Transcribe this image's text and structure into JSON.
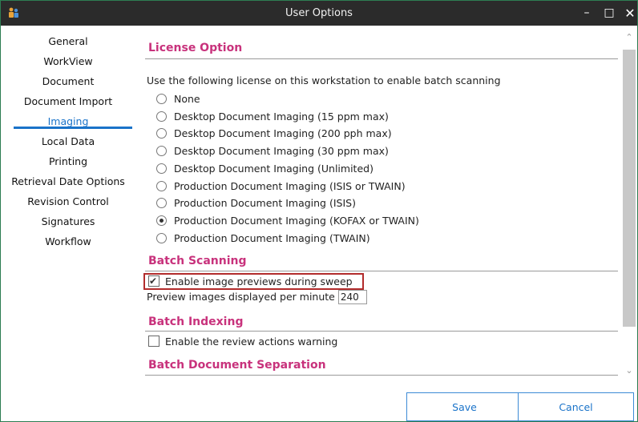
{
  "window": {
    "title": "User Options",
    "minimize_glyph": "–",
    "maximize_glyph": "□",
    "close_glyph": "✕"
  },
  "sidebar": {
    "items": [
      {
        "label": "General"
      },
      {
        "label": "WorkView"
      },
      {
        "label": "Document"
      },
      {
        "label": "Document Import"
      },
      {
        "label": "Imaging",
        "active": true
      },
      {
        "label": "Local Data"
      },
      {
        "label": "Printing"
      },
      {
        "label": "Retrieval Date Options"
      },
      {
        "label": "Revision Control"
      },
      {
        "label": "Signatures"
      },
      {
        "label": "Workflow"
      }
    ]
  },
  "license": {
    "title": "License Option",
    "description": "Use the following license on this workstation to enable batch scanning",
    "options": [
      {
        "label": "None",
        "selected": false
      },
      {
        "label": "Desktop Document Imaging (15 ppm max)",
        "selected": false
      },
      {
        "label": "Desktop Document Imaging (200 pph max)",
        "selected": false
      },
      {
        "label": "Desktop Document Imaging (30 ppm max)",
        "selected": false
      },
      {
        "label": "Desktop Document Imaging (Unlimited)",
        "selected": false
      },
      {
        "label": "Production Document Imaging (ISIS or TWAIN)",
        "selected": false
      },
      {
        "label": "Production Document Imaging (ISIS)",
        "selected": false
      },
      {
        "label": "Production Document Imaging (KOFAX or TWAIN)",
        "selected": true
      },
      {
        "label": "Production Document Imaging (TWAIN)",
        "selected": false
      }
    ]
  },
  "batch_scanning": {
    "title": "Batch Scanning",
    "enable_previews_label": "Enable image previews during sweep",
    "enable_previews_checked": true,
    "preview_rate_label": "Preview images displayed per minute",
    "preview_rate_value": "240"
  },
  "batch_indexing": {
    "title": "Batch Indexing",
    "review_warning_label": "Enable the review actions warning",
    "review_warning_checked": false
  },
  "batch_separation": {
    "title": "Batch Document Separation"
  },
  "buttons": {
    "save_label": "Save",
    "cancel_label": "Cancel"
  },
  "colors": {
    "accent": "#1a73c9",
    "section_heading": "#c8327c",
    "titlebar": "#2b2b2b",
    "highlight": "#b22c2c"
  }
}
